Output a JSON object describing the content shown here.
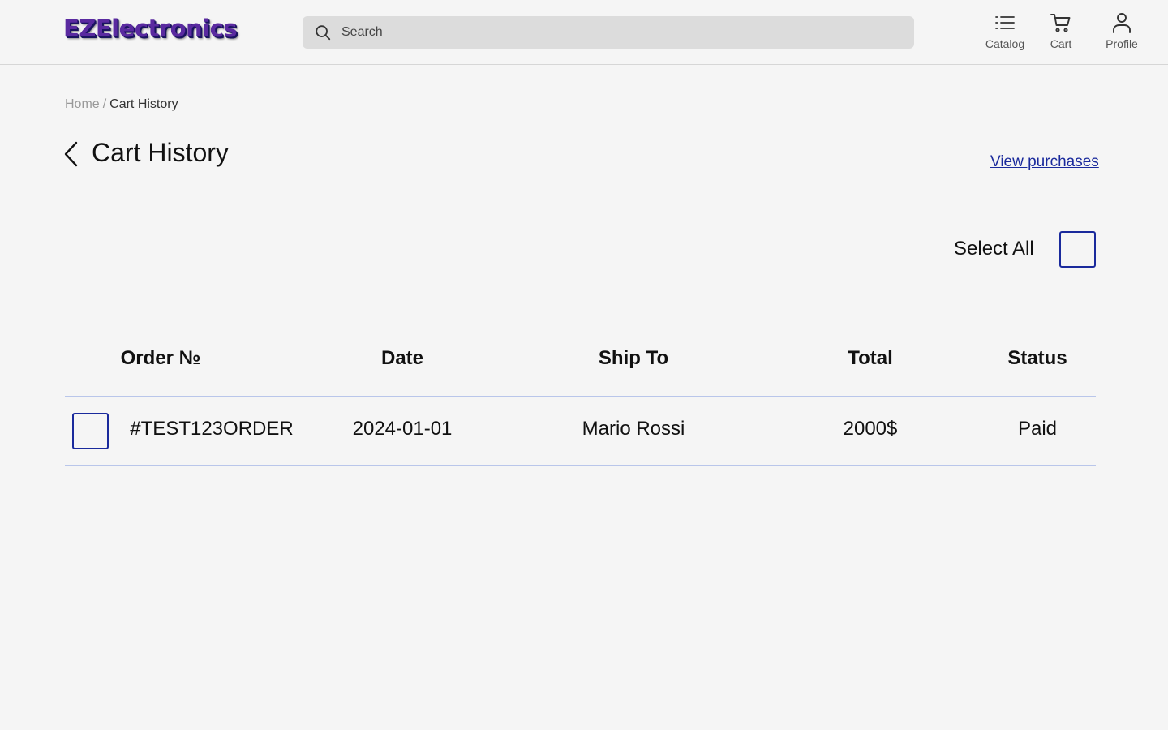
{
  "header": {
    "logo_text": "EZElectronics",
    "search": {
      "placeholder": "Search",
      "value": ""
    },
    "nav": {
      "catalog": {
        "label": "Catalog",
        "icon": "list-icon"
      },
      "cart": {
        "label": "Cart",
        "icon": "cart-icon"
      },
      "profile": {
        "label": "Profile",
        "icon": "user-icon"
      }
    }
  },
  "breadcrumb": {
    "home": "Home",
    "separator": "/",
    "current": "Cart History"
  },
  "page": {
    "title": "Cart History",
    "back_icon": "chevron-left-icon",
    "view_purchases_link": "View purchases",
    "select_all_label": "Select All",
    "select_all_checked": false
  },
  "table": {
    "columns": [
      "Order №",
      "Date",
      "Ship To",
      "Total",
      "Status"
    ],
    "rows": [
      {
        "checked": false,
        "order_no": "#TEST123ORDER",
        "date": "2024-01-01",
        "ship_to": "Mario Rossi",
        "total": "2000$",
        "status": "Paid"
      }
    ]
  },
  "colors": {
    "background": "#f5f5f5",
    "accent": "#1a2a9c",
    "logo": "#5a2aa0",
    "row_rule": "#b9c6ea"
  }
}
